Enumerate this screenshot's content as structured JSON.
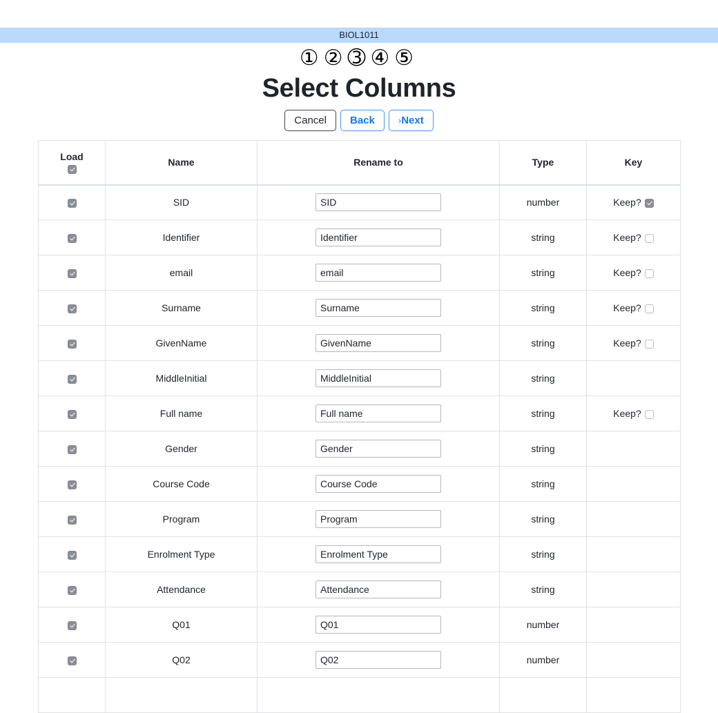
{
  "banner": {
    "course": "BIOL1011"
  },
  "steps": {
    "items": [
      {
        "label": "①",
        "active": false
      },
      {
        "label": "②",
        "active": false
      },
      {
        "label": "➂",
        "active": true
      },
      {
        "label": "④",
        "active": false
      },
      {
        "label": "⑤",
        "active": false
      }
    ],
    "current": 3,
    "total": 5
  },
  "page": {
    "title": "Select Columns"
  },
  "actions": {
    "cancel_label": "Cancel",
    "back_label": "Back",
    "next_label": "Next",
    "next_chevron": "›"
  },
  "table": {
    "headers": {
      "load": "Load",
      "name": "Name",
      "rename": "Rename to",
      "type": "Type",
      "key": "Key"
    },
    "header_load_checked": true,
    "key_label": "Keep?",
    "rows": [
      {
        "load": true,
        "name": "SID",
        "rename": "SID",
        "type": "number",
        "has_key": true,
        "key_checked": true
      },
      {
        "load": true,
        "name": "Identifier",
        "rename": "Identifier",
        "type": "string",
        "has_key": true,
        "key_checked": false
      },
      {
        "load": true,
        "name": "email",
        "rename": "email",
        "type": "string",
        "has_key": true,
        "key_checked": false
      },
      {
        "load": true,
        "name": "Surname",
        "rename": "Surname",
        "type": "string",
        "has_key": true,
        "key_checked": false
      },
      {
        "load": true,
        "name": "GivenName",
        "rename": "GivenName",
        "type": "string",
        "has_key": true,
        "key_checked": false
      },
      {
        "load": true,
        "name": "MiddleInitial",
        "rename": "MiddleInitial",
        "type": "string",
        "has_key": false,
        "key_checked": false
      },
      {
        "load": true,
        "name": "Full name",
        "rename": "Full name",
        "type": "string",
        "has_key": true,
        "key_checked": false
      },
      {
        "load": true,
        "name": "Gender",
        "rename": "Gender",
        "type": "string",
        "has_key": false,
        "key_checked": false
      },
      {
        "load": true,
        "name": "Course Code",
        "rename": "Course Code",
        "type": "string",
        "has_key": false,
        "key_checked": false
      },
      {
        "load": true,
        "name": "Program",
        "rename": "Program",
        "type": "string",
        "has_key": false,
        "key_checked": false
      },
      {
        "load": true,
        "name": "Enrolment Type",
        "rename": "Enrolment Type",
        "type": "string",
        "has_key": false,
        "key_checked": false
      },
      {
        "load": true,
        "name": "Attendance",
        "rename": "Attendance",
        "type": "string",
        "has_key": false,
        "key_checked": false
      },
      {
        "load": true,
        "name": "Q01",
        "rename": "Q01",
        "type": "number",
        "has_key": false,
        "key_checked": false
      },
      {
        "load": true,
        "name": "Q02",
        "rename": "Q02",
        "type": "number",
        "has_key": false,
        "key_checked": false
      },
      {
        "load": true,
        "name": "",
        "rename": "",
        "type": "",
        "has_key": false,
        "key_checked": false
      }
    ]
  },
  "colors": {
    "banner": "#b9d9fd",
    "link": "#1477f2",
    "title": "#1f242a",
    "border": "#dee2e6",
    "checkbox_on": "#8b8f94"
  }
}
